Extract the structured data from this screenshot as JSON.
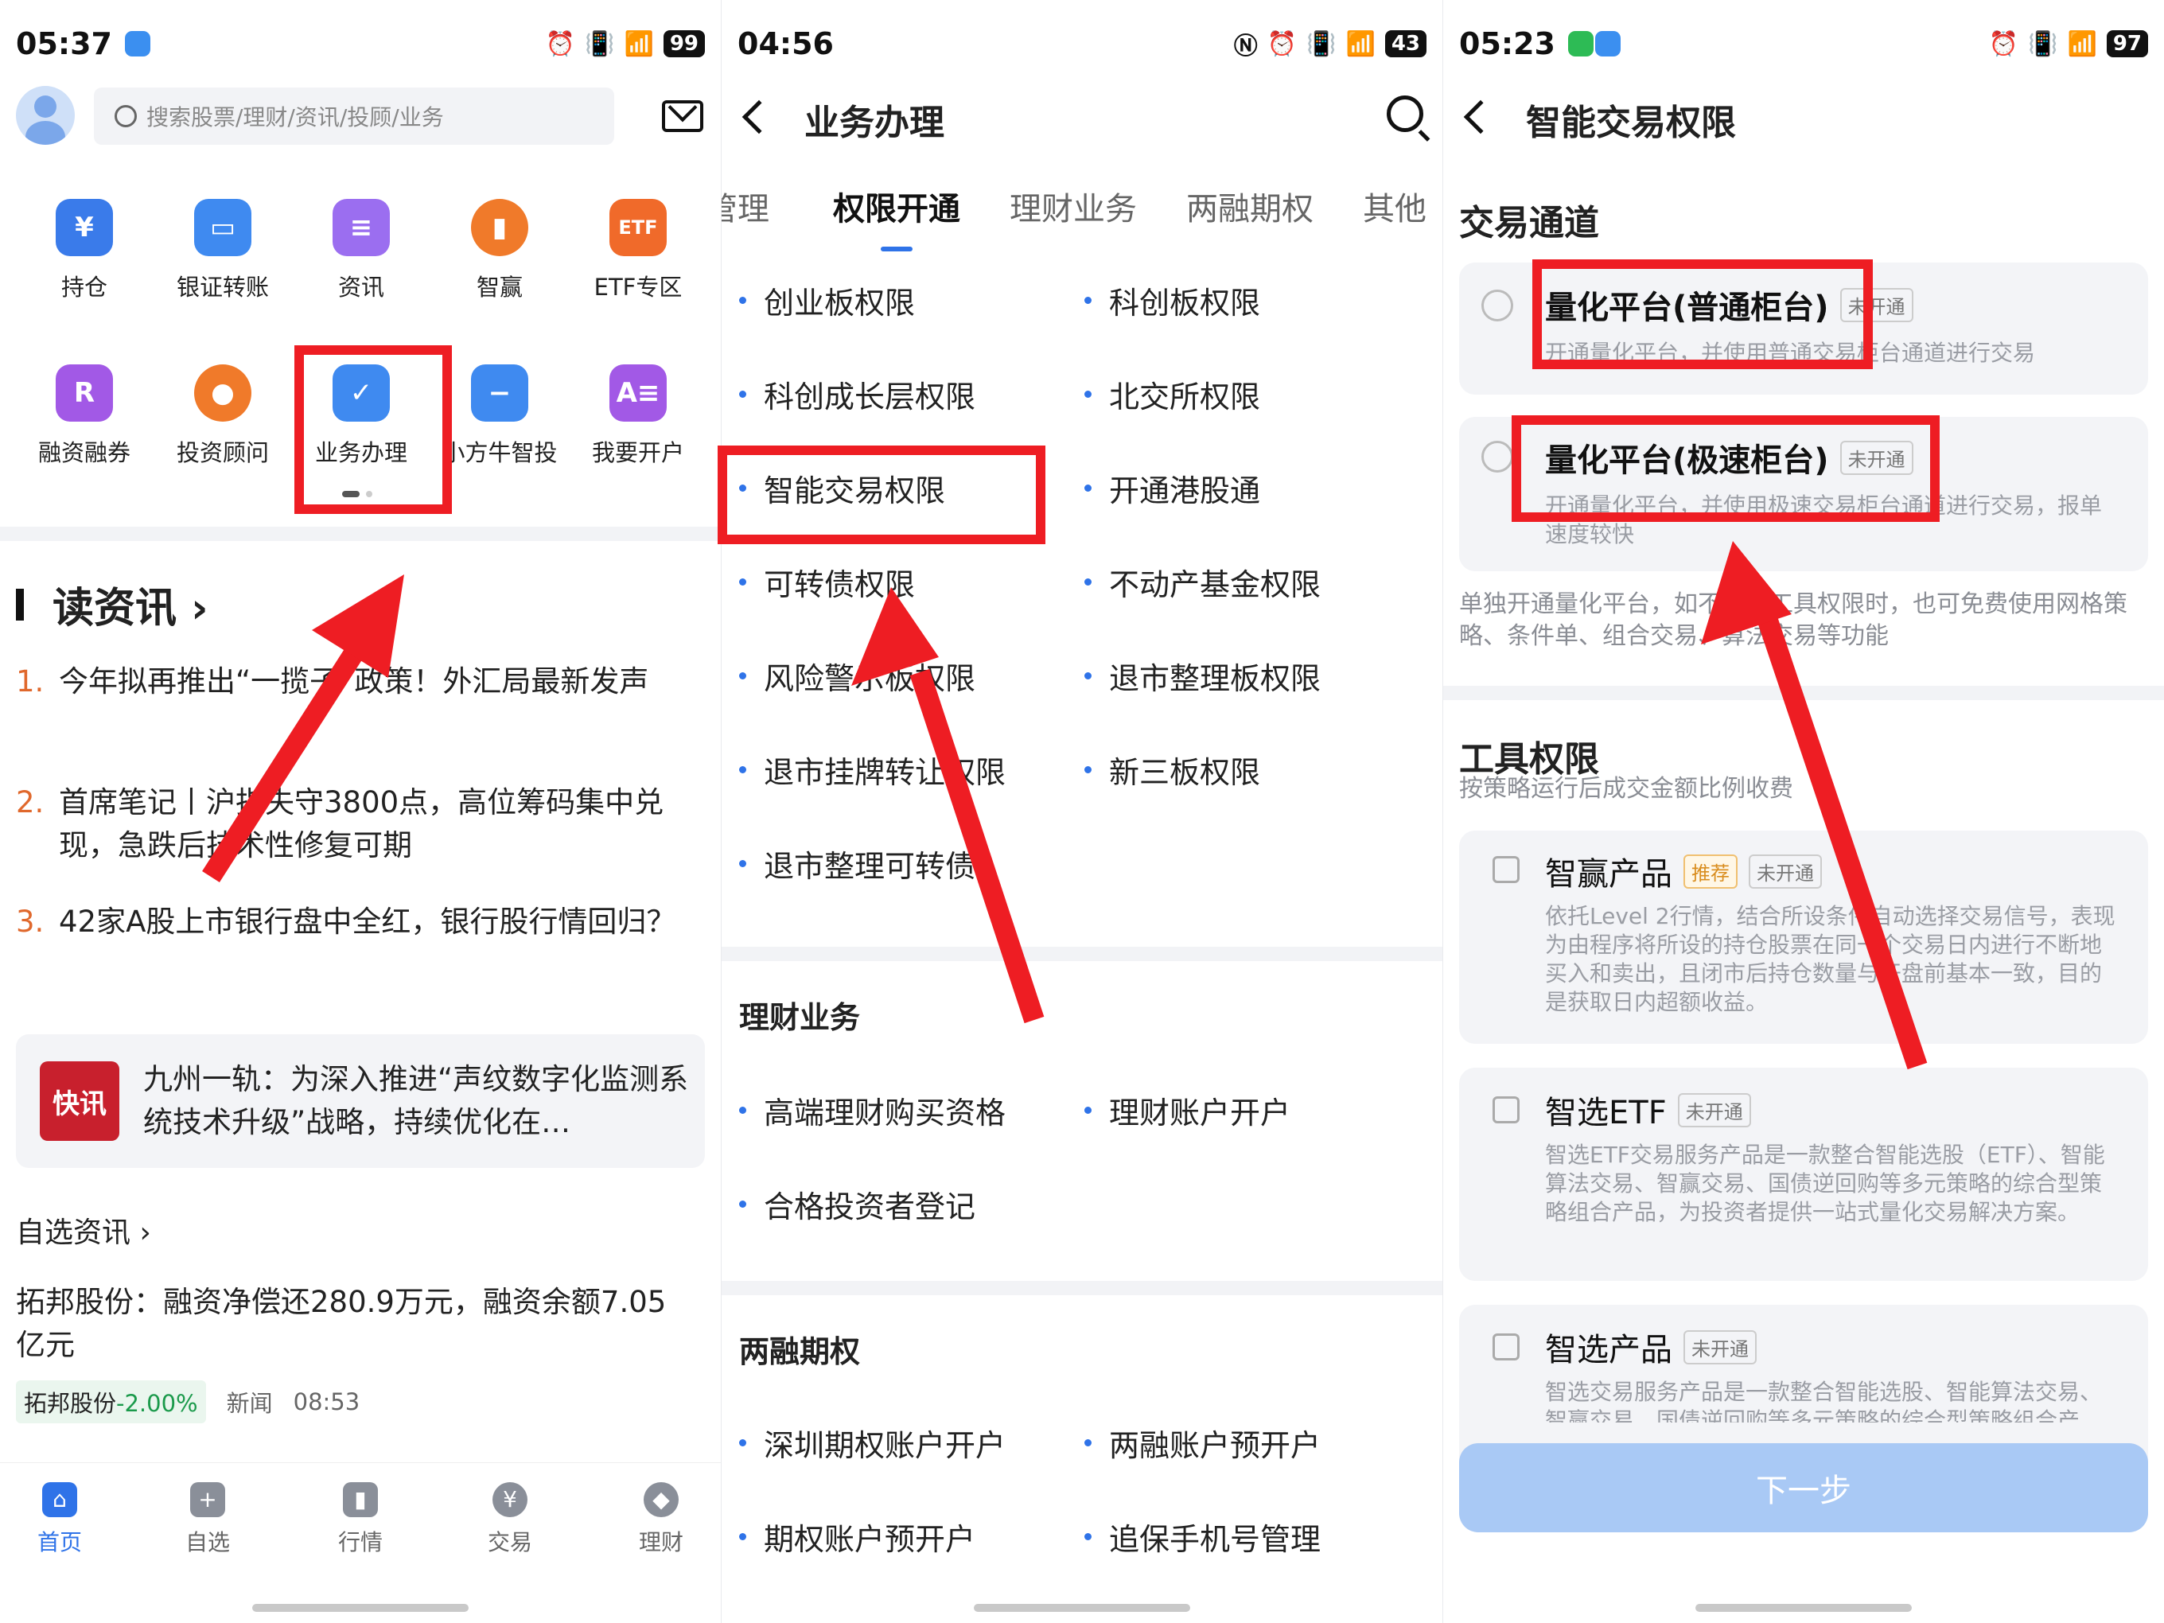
{
  "s1": {
    "time": "05:37",
    "battery": "99",
    "search_placeholder": "搜索股票/理财/资讯/投顾/业务",
    "grid": [
      "持仓",
      "银证转账",
      "资讯",
      "智赢",
      "ETF专区",
      "融资融券",
      "投资顾问",
      "业务办理",
      "小方牛智投",
      "我要开户"
    ],
    "section_title": "读资讯 ›",
    "news": [
      {
        "num": "1.",
        "text": "今年拟再推出“一揽子”政策！外汇局最新发声"
      },
      {
        "num": "2.",
        "text": "首席笔记丨沪指失守3800点，高位筹码集中兑现，急跌后技术性修复可期"
      },
      {
        "num": "3.",
        "text": "42家A股上市银行盘中全红，银行股行情回归？"
      }
    ],
    "flash_badge": "快讯",
    "flash_text": "九州一轨：为深入推进“声纹数字化监测系统技术升级”战略，持续优化在…",
    "sub_title": "自选资讯 ›",
    "stock_news": "拓邦股份：融资净偿还280.9万元，融资余额7.05亿元",
    "stock_tag_name": "拓邦股份",
    "stock_tag_change": "-2.00%",
    "news_type": "新闻",
    "news_time": "08:53",
    "tabs": [
      "首页",
      "自选",
      "行情",
      "交易",
      "理财"
    ]
  },
  "s2": {
    "time": "04:56",
    "battery": "43",
    "title": "业务办理",
    "tabs": [
      "管理",
      "权限开通",
      "理财业务",
      "两融期权",
      "其他"
    ],
    "items": [
      "创业板权限",
      "科创板权限",
      "科创成长层权限",
      "北交所权限",
      "智能交易权限",
      "开通港股通",
      "可转债权限",
      "不动产基金权限",
      "风险警示板权限",
      "退市整理板权限",
      "退市挂牌转让权限",
      "新三板权限",
      "退市整理可转债"
    ],
    "sec2": "理财业务",
    "items2": [
      "高端理财购买资格",
      "理财账户开户",
      "合格投资者登记"
    ],
    "sec3": "两融期权",
    "items3": [
      "深圳期权账户开户",
      "两融账户预开户",
      "期权账户预开户",
      "追保手机号管理"
    ]
  },
  "s3": {
    "time": "05:23",
    "battery": "97",
    "title": "智能交易权限",
    "channel_title": "交易通道",
    "opt1_title": "量化平台(普通柜台)",
    "opt1_tag": "未开通",
    "opt1_desc": "开通量化平台，并使用普通交易柜台通道进行交易",
    "opt2_title": "量化平台(极速柜台)",
    "opt2_tag": "未开通",
    "opt2_desc": "开通量化平台，并使用极速交易柜台通道进行交易，报单速度较快",
    "note": "单独开通量化平台，如不开通工具权限时，也可免费使用网格策略、条件单、组合交易、算法交易等功能",
    "tool_title": "工具权限",
    "tool_sub": "按策略运行后成交金额比例收费",
    "p1_title": "智赢产品",
    "p1_rec": "推荐",
    "p1_tag": "未开通",
    "p1_desc": "依托Level 2行情，结合所设条件自动选择交易信号，表现为由程序将所设的持仓股票在同一个交易日内进行不断地买入和卖出，且闭市后持仓数量与开盘前基本一致，目的是获取日内超额收益。",
    "p2_title": "智选ETF",
    "p2_tag": "未开通",
    "p2_desc": "智选ETF交易服务产品是一款整合智能选股（ETF）、智能算法交易、智赢交易、国债逆回购等多元策略的综合型策略组合产品，为投资者提供一站式量化交易解决方案。",
    "p3_title": "智选产品",
    "p3_tag": "未开通",
    "p3_desc": "智选交易服务产品是一款整合智能选股、智能算法交易、智赢交易、国债逆回购等多元策略的综合型策略组合产品，为投资者提供一站式量化交易解决方案。",
    "next": "下一步"
  },
  "colors": {
    "accent": "#2f73e8",
    "annotation_red": "#ee1d23",
    "up_green": "#1b9a4b"
  }
}
